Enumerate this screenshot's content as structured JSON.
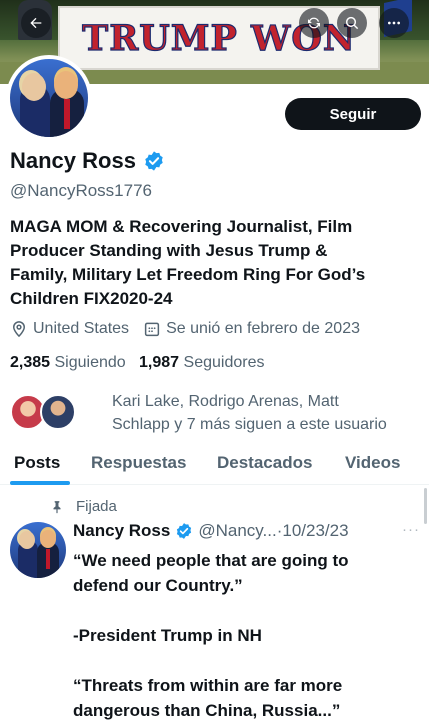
{
  "banner": {
    "sign_text": "TRUMP WON"
  },
  "header": {
    "back_icon": "back-arrow-icon",
    "refresh_icon": "refresh-icon",
    "search_icon": "search-icon",
    "more_icon": "more-icon"
  },
  "profile": {
    "name": "Nancy Ross",
    "handle": "@NancyRoss1776",
    "follow_label": "Seguir",
    "bio_lines": [
      "MAGA MOM & Recovering Journalist, Film",
      "Producer Standing with Jesus Trump &",
      "Family, Military Let Freedom Ring For God’s",
      "Children FIX2020-24"
    ],
    "location": "United States",
    "joined": "Se unió en febrero de 2023",
    "following_count": "2,385",
    "following_label": "Siguiendo",
    "followers_count": "1,987",
    "followers_label": "Seguidores",
    "known_followers_lines": [
      "Kari Lake, Rodrigo Arenas, Matt",
      "Schlapp y 7 más siguen a este usuario"
    ]
  },
  "tabs": [
    {
      "label": "Posts",
      "active": true
    },
    {
      "label": "Respuestas",
      "active": false
    },
    {
      "label": "Destacados",
      "active": false
    },
    {
      "label": "Videos",
      "active": false
    }
  ],
  "pinned_post": {
    "pinned_label": "Fijada",
    "author": "Nancy Ross",
    "handle": "@Nancy...",
    "date": "10/23/23",
    "separator": "·",
    "more": "···",
    "lines": [
      "“We need people that are going to",
      "defend our Country.”",
      "",
      "-President Trump in NH",
      "",
      "“Threats from within are far more",
      "dangerous than China, Russia...”"
    ]
  },
  "colors": {
    "accent": "#1d9bf0",
    "text": "#0f1419",
    "muted": "#536471"
  }
}
